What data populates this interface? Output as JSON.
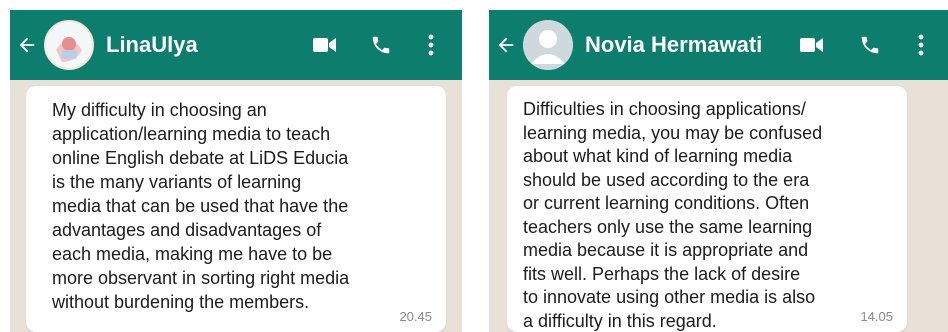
{
  "chats": [
    {
      "contact_name": "LinaUlya",
      "icons": {
        "back": "back-arrow-icon",
        "video": "video-call-icon",
        "voice": "voice-call-icon",
        "menu": "more-vert-icon"
      },
      "message": {
        "text": "My difficulty in choosing an\napplication/learning media to teach\nonline English debate at LiDS Educia\nis the many variants of learning\nmedia that can be used that have the\nadvantages and disadvantages of\neach media, making me have to be\nmore observant in sorting right media\nwithout burdening the members.",
        "time": "20.45"
      }
    },
    {
      "contact_name": "Novia Hermawati",
      "icons": {
        "back": "back-arrow-icon",
        "video": "video-call-icon",
        "voice": "voice-call-icon",
        "menu": "more-vert-icon"
      },
      "message": {
        "text": "Difficulties in choosing applications/\nlearning media, you may be confused\nabout what kind of learning media\nshould be used according to the era\nor current learning conditions.  Often\nteachers only use the same learning\nmedia because it is appropriate and\nfits well.  Perhaps the lack of desire\nto innovate using other media is also\na difficulty in this regard.",
        "time": "14.05"
      }
    }
  ],
  "colors": {
    "header": "#0d7e6e",
    "chat_background": "#e9e1d7",
    "bubble": "#ffffff",
    "timestamp": "#8a8a8a"
  }
}
